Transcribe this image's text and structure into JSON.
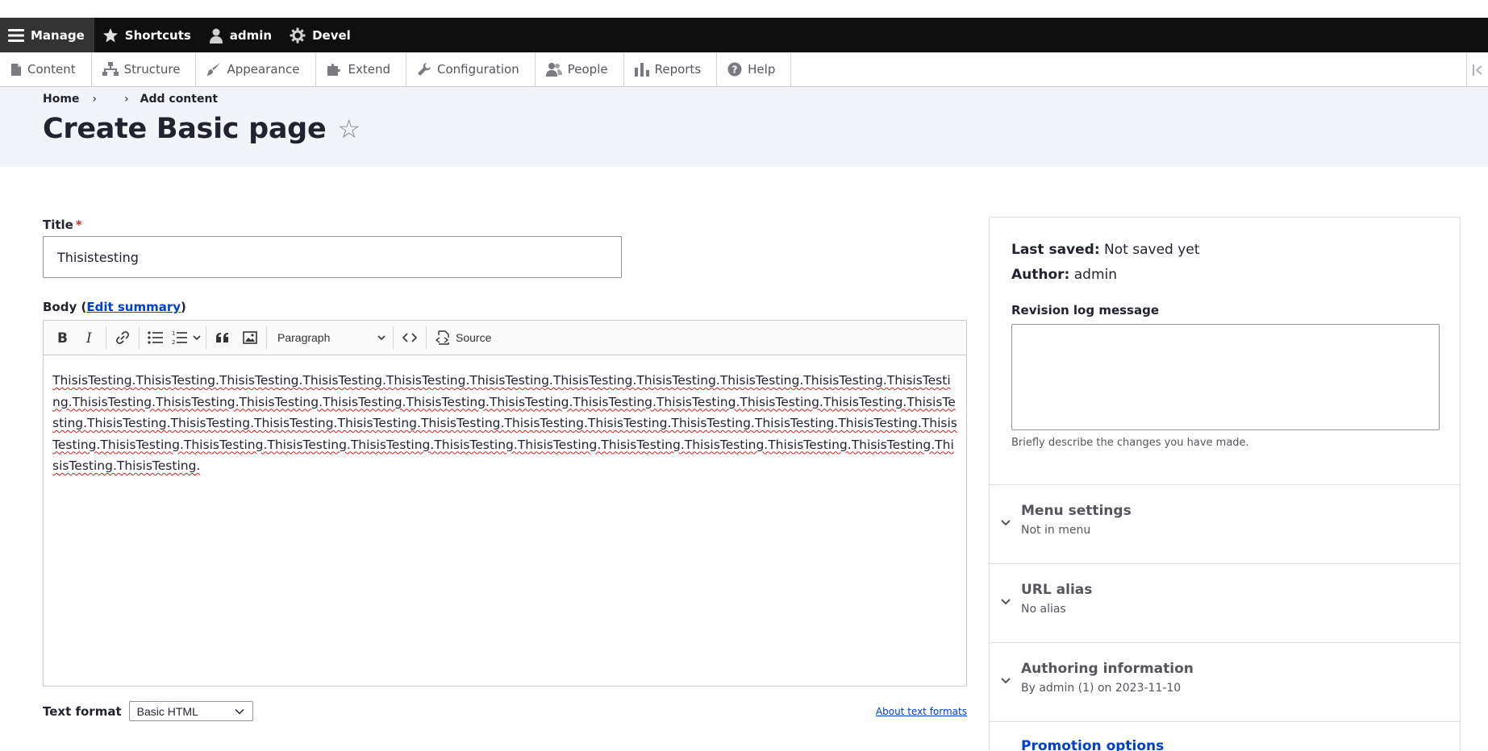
{
  "toolbar": {
    "manage": "Manage",
    "shortcuts": "Shortcuts",
    "user": "admin",
    "devel": "Devel"
  },
  "tray": {
    "items": [
      "Content",
      "Structure",
      "Appearance",
      "Extend",
      "Configuration",
      "People",
      "Reports",
      "Help"
    ]
  },
  "breadcrumb": {
    "home": "Home",
    "sep1": "›",
    "sep2": "›",
    "current": "Add content"
  },
  "page": {
    "title": "Create Basic page",
    "star": "☆"
  },
  "form": {
    "title_label": "Title",
    "required_mark": "*",
    "title_value": "Thisistesting",
    "body_label_prefix": "Body (",
    "edit_summary": "Edit summary",
    "body_label_suffix": ")",
    "paragraph": "Paragraph",
    "source": "Source",
    "body_text": "ThisisTesting.ThisisTesting.ThisisTesting.ThisisTesting.ThisisTesting.ThisisTesting.ThisisTesting.ThisisTesting.ThisisTesting.ThisisTesting.ThisisTesting.ThisisTesting.ThisisTesting.ThisisTesting.ThisisTesting.ThisisTesting.ThisisTesting.ThisisTesting.ThisisTesting.ThisisTesting.ThisisTesting.ThisisTesting.ThisisTesting.ThisisTesting.ThisisTesting.ThisisTesting.ThisisTesting.ThisisTesting.ThisisTesting.ThisisTesting.ThisisTesting.ThisisTesting.ThisisTesting.ThisisTesting.ThisisTesting.ThisisTesting.ThisisTesting.ThisisTesting.ThisisTesting.ThisisTesting.ThisisTesting.ThisisTesting.ThisisTesting.ThisisTesting.ThisisTesting.",
    "text_format_label": "Text format",
    "text_format_value": "Basic HTML",
    "about_text_formats": "About text formats"
  },
  "sidebar": {
    "last_saved_label": "Last saved:",
    "last_saved_value": "Not saved yet",
    "author_label": "Author:",
    "author_value": "admin",
    "revision_label": "Revision log message",
    "revision_desc": "Briefly describe the changes you have made.",
    "sections": [
      {
        "title": "Menu settings",
        "summary": "Not in menu"
      },
      {
        "title": "URL alias",
        "summary": "No alias"
      },
      {
        "title": "Authoring information",
        "summary": "By admin (1) on 2023-11-10"
      }
    ],
    "promotion": "Promotion options"
  }
}
